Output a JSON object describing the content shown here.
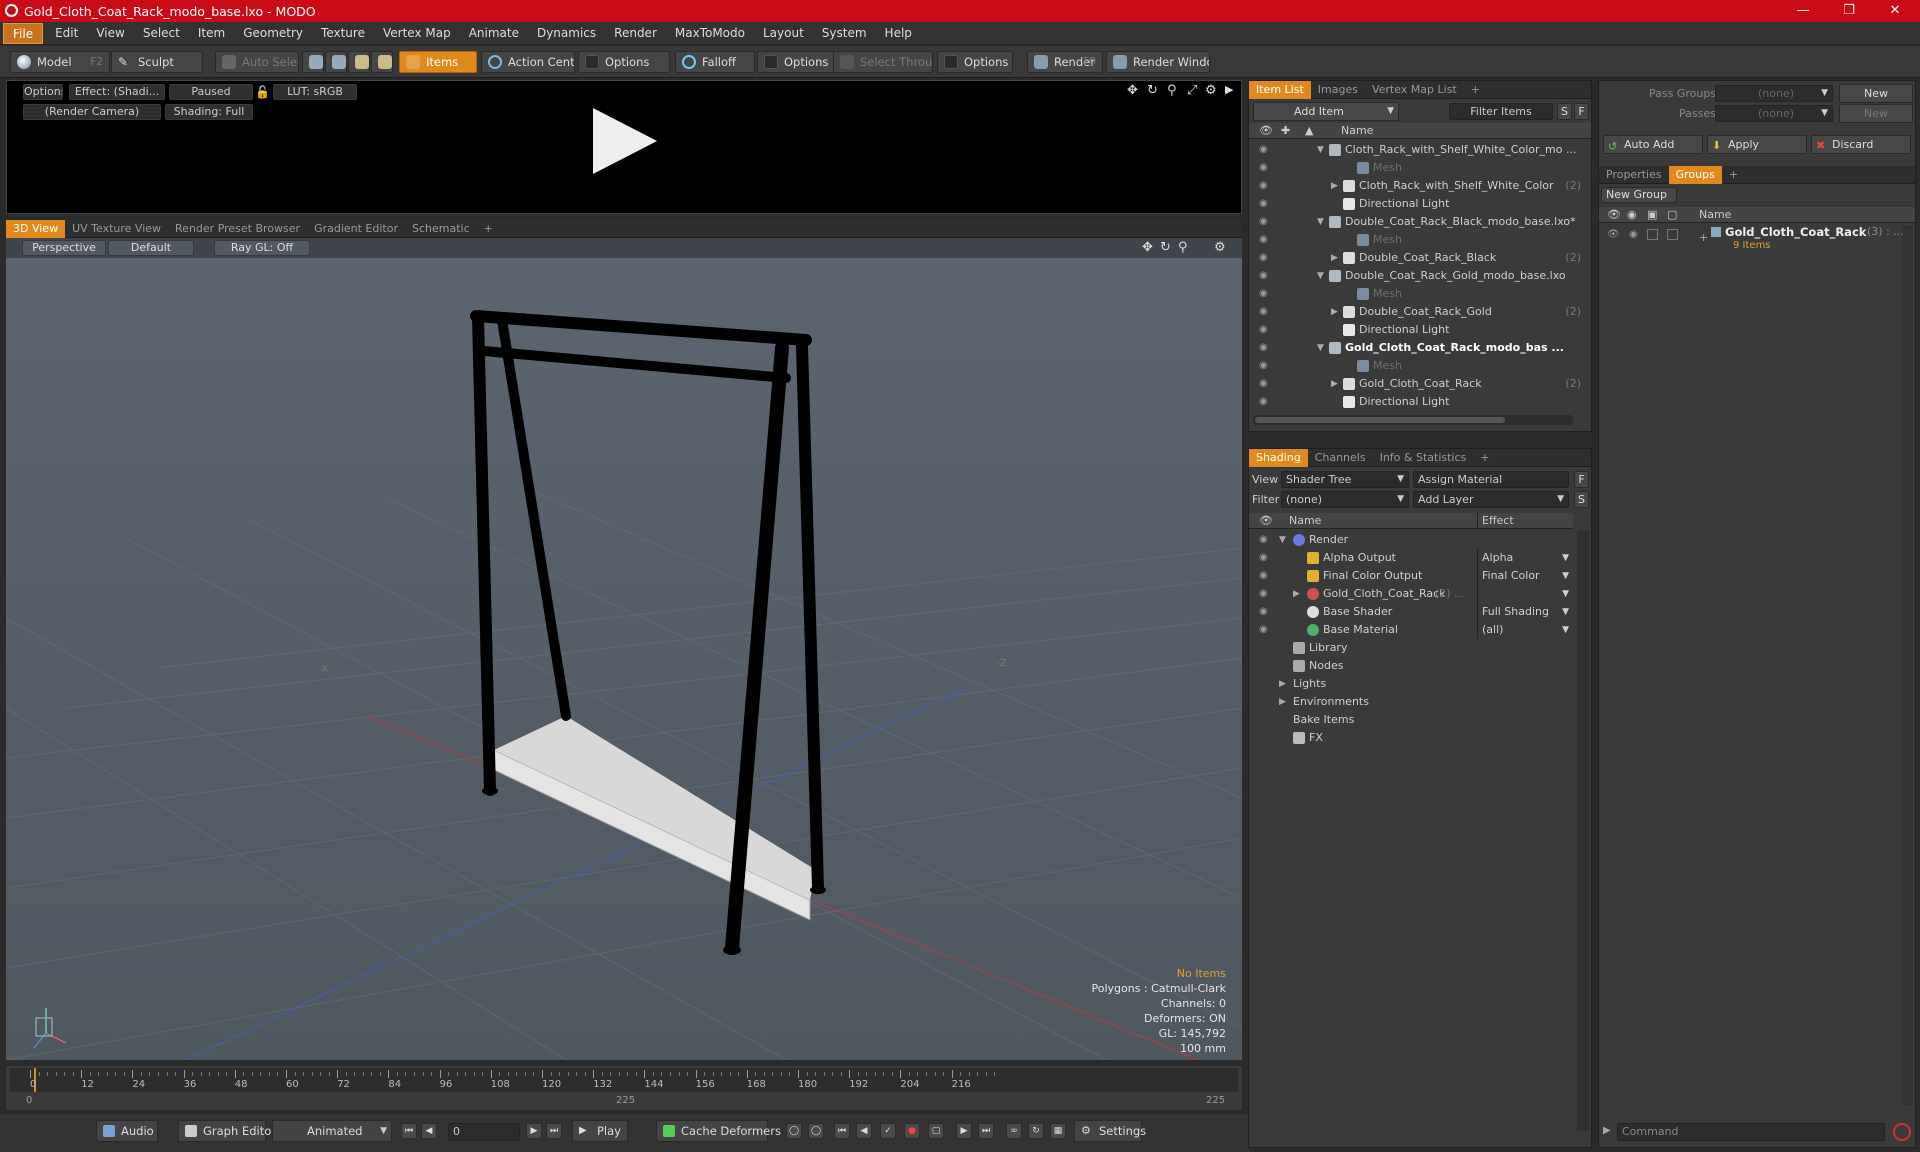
{
  "window": {
    "title": "Gold_Cloth_Coat_Rack_modo_base.lxo - MODO"
  },
  "menu": [
    "File",
    "Edit",
    "View",
    "Select",
    "Item",
    "Geometry",
    "Texture",
    "Vertex Map",
    "Animate",
    "Dynamics",
    "Render",
    "MaxToModo",
    "Layout",
    "System",
    "Help"
  ],
  "toolbar": {
    "model": "Model",
    "model_key": "F2",
    "sculpt": "Sculpt",
    "auto_select": "Auto Select",
    "items": "Items",
    "action_center": "Action Center",
    "options1": "Options",
    "falloff": "Falloff",
    "options2": "Options",
    "select_through": "Select Through",
    "options3": "Options",
    "render": "Render",
    "render_key": "F9",
    "render_window": "Render Window"
  },
  "preview": {
    "options": "Options",
    "effect": "Effect: (Shadi...",
    "paused": "Paused",
    "lut": "LUT: sRGB",
    "camera": "(Render Camera)",
    "shading": "Shading: Full"
  },
  "viewtabs": [
    "3D View",
    "UV Texture View",
    "Render Preset Browser",
    "Gradient Editor",
    "Schematic",
    "+"
  ],
  "viewport": {
    "perspective": "Perspective",
    "default": "Default",
    "raygl": "Ray GL: Off",
    "axis_x": "-X",
    "axis_z": "-Z",
    "stats": {
      "no_items": "No Items",
      "polygons": "Polygons : Catmull-Clark",
      "channels": "Channels: 0",
      "deformers": "Deformers: ON",
      "gl": "GL: 145,792",
      "scale": "100 mm"
    }
  },
  "timeline": {
    "ticks": [
      "0",
      "12",
      "24",
      "36",
      "48",
      "60",
      "72",
      "84",
      "96",
      "108",
      "120",
      "132",
      "144",
      "156",
      "168",
      "180",
      "192",
      "204",
      "216"
    ],
    "low": [
      "0",
      "225",
      "225"
    ]
  },
  "bottombar": {
    "audio": "Audio",
    "graph_editor": "Graph Editor",
    "animated": "Animated",
    "frame": "0",
    "play": "Play",
    "cache": "Cache Deformers",
    "settings": "Settings"
  },
  "item_list": {
    "tabs": [
      "Item List",
      "Images",
      "Vertex Map List",
      "+"
    ],
    "add_item": "Add Item",
    "filter": "Filter Items",
    "s": "S",
    "f": "F",
    "col_name": "Name",
    "rows": [
      {
        "label": "Cloth_Rack_with_Shelf_White_Color_mo ...",
        "indent": 0,
        "kind": "scene",
        "bold": false,
        "dim": false,
        "tri": "▼",
        "count": ""
      },
      {
        "label": "Mesh",
        "indent": 2,
        "kind": "mesh",
        "bold": false,
        "dim": true,
        "tri": "",
        "count": ""
      },
      {
        "label": "Cloth_Rack_with_Shelf_White_Color",
        "indent": 1,
        "kind": "locator",
        "bold": false,
        "dim": false,
        "tri": "▶",
        "count": "(2)"
      },
      {
        "label": "Directional Light",
        "indent": 1,
        "kind": "light",
        "bold": false,
        "dim": false,
        "tri": "",
        "count": ""
      },
      {
        "label": "Double_Coat_Rack_Black_modo_base.lxo*",
        "indent": 0,
        "kind": "scene",
        "bold": false,
        "dim": false,
        "tri": "▼",
        "count": ""
      },
      {
        "label": "Mesh",
        "indent": 2,
        "kind": "mesh",
        "bold": false,
        "dim": true,
        "tri": "",
        "count": ""
      },
      {
        "label": "Double_Coat_Rack_Black",
        "indent": 1,
        "kind": "locator",
        "bold": false,
        "dim": false,
        "tri": "▶",
        "count": "(2)"
      },
      {
        "label": "Double_Coat_Rack_Gold_modo_base.lxo",
        "indent": 0,
        "kind": "scene",
        "bold": false,
        "dim": false,
        "tri": "▼",
        "count": ""
      },
      {
        "label": "Mesh",
        "indent": 2,
        "kind": "mesh",
        "bold": false,
        "dim": true,
        "tri": "",
        "count": ""
      },
      {
        "label": "Double_Coat_Rack_Gold",
        "indent": 1,
        "kind": "locator",
        "bold": false,
        "dim": false,
        "tri": "▶",
        "count": "(2)"
      },
      {
        "label": "Directional Light",
        "indent": 1,
        "kind": "light",
        "bold": false,
        "dim": false,
        "tri": "",
        "count": ""
      },
      {
        "label": "Gold_Cloth_Coat_Rack_modo_bas ...",
        "indent": 0,
        "kind": "scene",
        "bold": true,
        "dim": false,
        "tri": "▼",
        "count": ""
      },
      {
        "label": "Mesh",
        "indent": 2,
        "kind": "mesh",
        "bold": false,
        "dim": true,
        "tri": "",
        "count": ""
      },
      {
        "label": "Gold_Cloth_Coat_Rack",
        "indent": 1,
        "kind": "locator",
        "bold": false,
        "dim": false,
        "tri": "▶",
        "count": "(2)"
      },
      {
        "label": "Directional Light",
        "indent": 1,
        "kind": "light",
        "bold": false,
        "dim": false,
        "tri": "",
        "count": ""
      }
    ]
  },
  "shading": {
    "tabs": [
      "Shading",
      "Channels",
      "Info & Statistics",
      "+"
    ],
    "view_label": "View",
    "view_value": "Shader Tree",
    "assign": "Assign Material",
    "f": "F",
    "filter_label": "Filter",
    "filter_value": "(none)",
    "add_layer": "Add Layer",
    "s": "S",
    "col_name": "Name",
    "col_effect": "Effect",
    "rows": [
      {
        "label": "Render",
        "indent": 0,
        "kind": "render",
        "tri": "▼",
        "effect": "",
        "eye": true,
        "count": ""
      },
      {
        "label": "Alpha Output",
        "indent": 1,
        "kind": "output",
        "tri": "",
        "effect": "Alpha",
        "eye": true,
        "count": ""
      },
      {
        "label": "Final Color Output",
        "indent": 1,
        "kind": "output",
        "tri": "",
        "effect": "Final Color",
        "eye": true,
        "count": ""
      },
      {
        "label": "Gold_Cloth_Coat_Rack",
        "indent": 1,
        "kind": "material",
        "tri": "▶",
        "effect": "",
        "eye": true,
        "count": "(2) ..."
      },
      {
        "label": "Base Shader",
        "indent": 1,
        "kind": "shader",
        "tri": "",
        "effect": "Full Shading",
        "eye": true,
        "count": ""
      },
      {
        "label": "Base Material",
        "indent": 1,
        "kind": "basemat",
        "tri": "",
        "effect": "(all)",
        "eye": true,
        "count": ""
      },
      {
        "label": "Library",
        "indent": 0,
        "kind": "folder",
        "tri": "",
        "effect": "",
        "eye": false,
        "count": ""
      },
      {
        "label": "Nodes",
        "indent": 0,
        "kind": "folder",
        "tri": "",
        "effect": "",
        "eye": false,
        "count": ""
      },
      {
        "label": "Lights",
        "indent": 0,
        "kind": "none",
        "tri": "▶",
        "effect": "",
        "eye": false,
        "count": ""
      },
      {
        "label": "Environments",
        "indent": 0,
        "kind": "none",
        "tri": "▶",
        "effect": "",
        "eye": false,
        "count": ""
      },
      {
        "label": "Bake Items",
        "indent": 0,
        "kind": "none",
        "tri": "",
        "effect": "",
        "eye": false,
        "count": ""
      },
      {
        "label": "FX",
        "indent": 0,
        "kind": "fx",
        "tri": "",
        "effect": "",
        "eye": false,
        "count": ""
      }
    ]
  },
  "right": {
    "pass_groups": "Pass Groups",
    "pass_value": "(none)",
    "new": "New",
    "passes": "Passes",
    "passes_value": "(none)",
    "new2": "New",
    "auto_add": "Auto Add",
    "apply": "Apply",
    "discard": "Discard",
    "tabs": [
      "Properties",
      "Groups",
      "+"
    ],
    "new_group": "New Group",
    "col_name": "Name",
    "group_name": "Gold_Cloth_Coat_Rack",
    "group_count": "(3) : ...",
    "group_items": "9 Items",
    "command": "Command"
  },
  "colors": {
    "accent": "#e08a1e",
    "title_bar": "#c90b18"
  }
}
